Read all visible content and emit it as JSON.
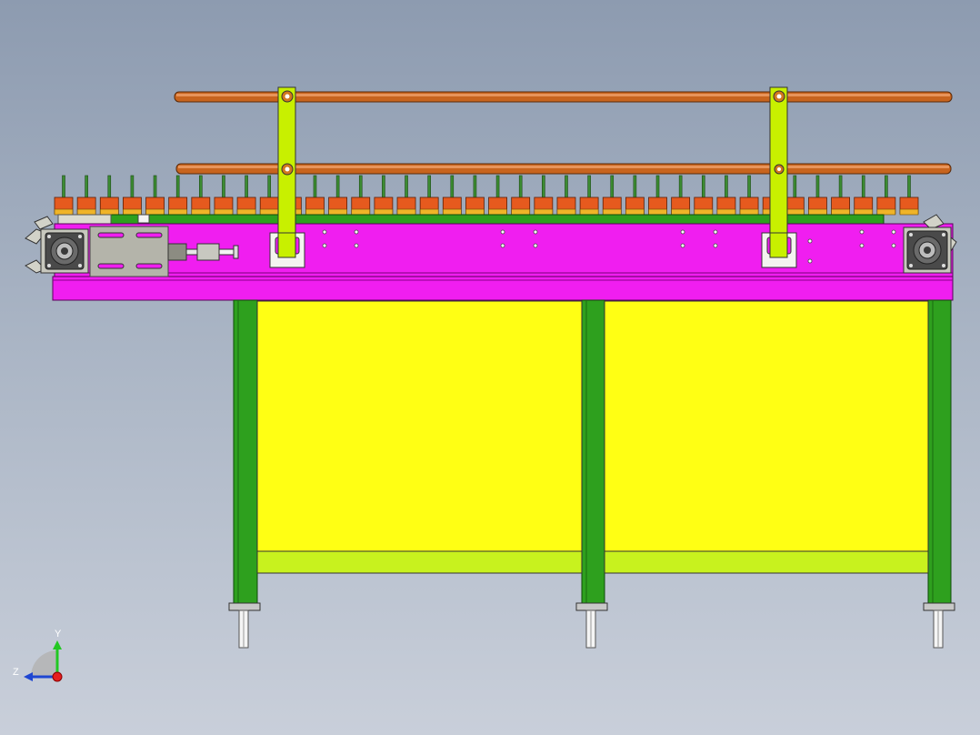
{
  "triad": {
    "y_label": "Y",
    "z_label": "Z"
  },
  "model": {
    "conveyor_cleats": 38,
    "colors": {
      "background_top": "#8d9bb0",
      "background_bottom": "#c9cfda",
      "frame_green": "#2ea01e",
      "lime": "#c8f21e",
      "magenta": "#f01ef0",
      "yellow_panel": "#ffff14",
      "pipe_orange": "#c8641e",
      "bracket_lime": "#c8f000",
      "steel_grey": "#b4b4aa",
      "cleat_orange": "#e65a1e"
    }
  }
}
